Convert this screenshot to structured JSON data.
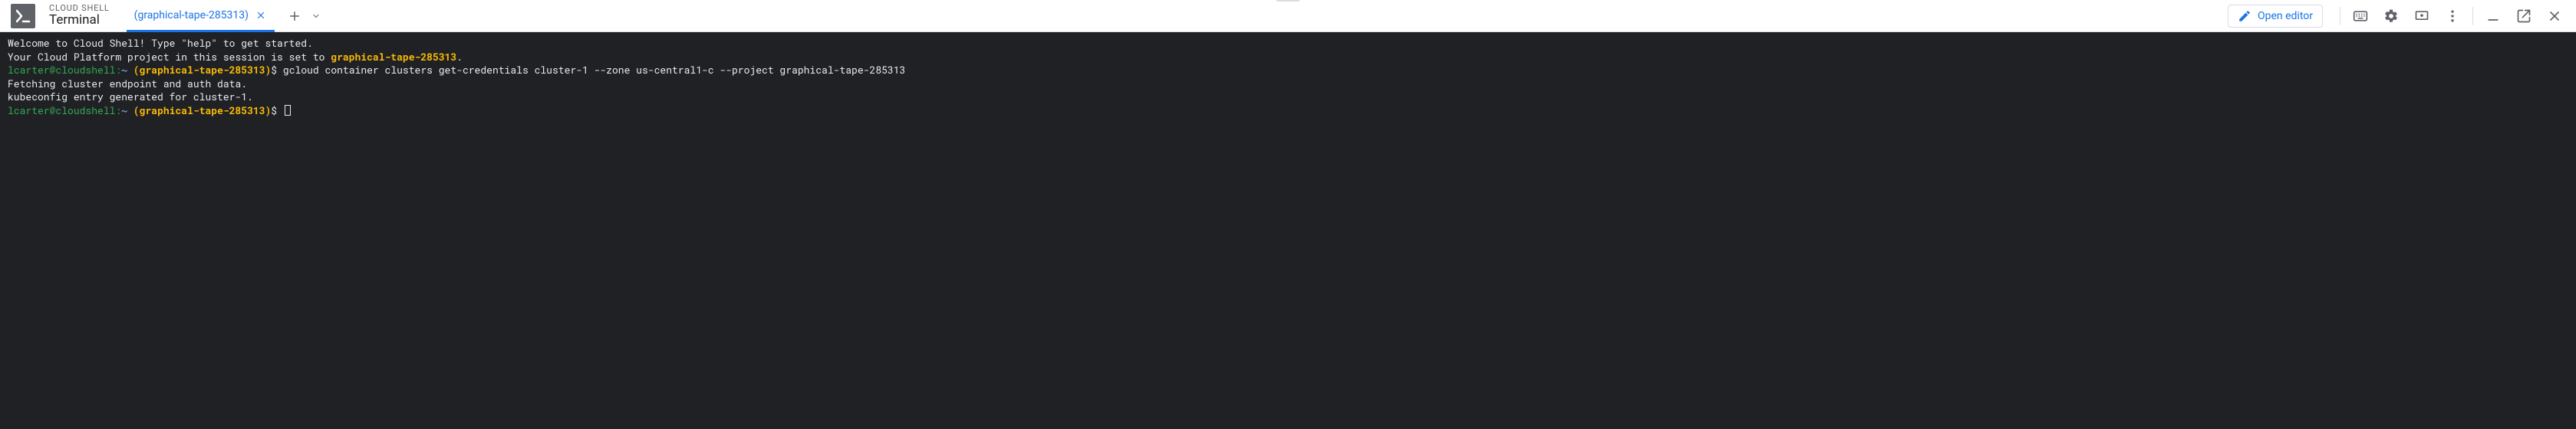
{
  "header": {
    "product_small": "CLOUD SHELL",
    "product_big": "Terminal",
    "tab_label": "(graphical-tape-285313)",
    "open_editor_label": "Open editor"
  },
  "terminal": {
    "welcome": "Welcome to Cloud Shell! Type \"help\" to get started.",
    "project_prefix": "Your Cloud Platform project in this session is set to ",
    "project_id": "graphical-tape-285313",
    "prompt_user": "lcarter@cloudshell:",
    "prompt_tilde": "~",
    "prompt_proj": "(graphical-tape-285313)",
    "prompt_dollar": "$",
    "cmd1": " gcloud container clusters get-credentials cluster-1 --zone us-central1-c --project graphical-tape-285313",
    "out1": "Fetching cluster endpoint and auth data.",
    "out2": "kubeconfig entry generated for cluster-1."
  }
}
